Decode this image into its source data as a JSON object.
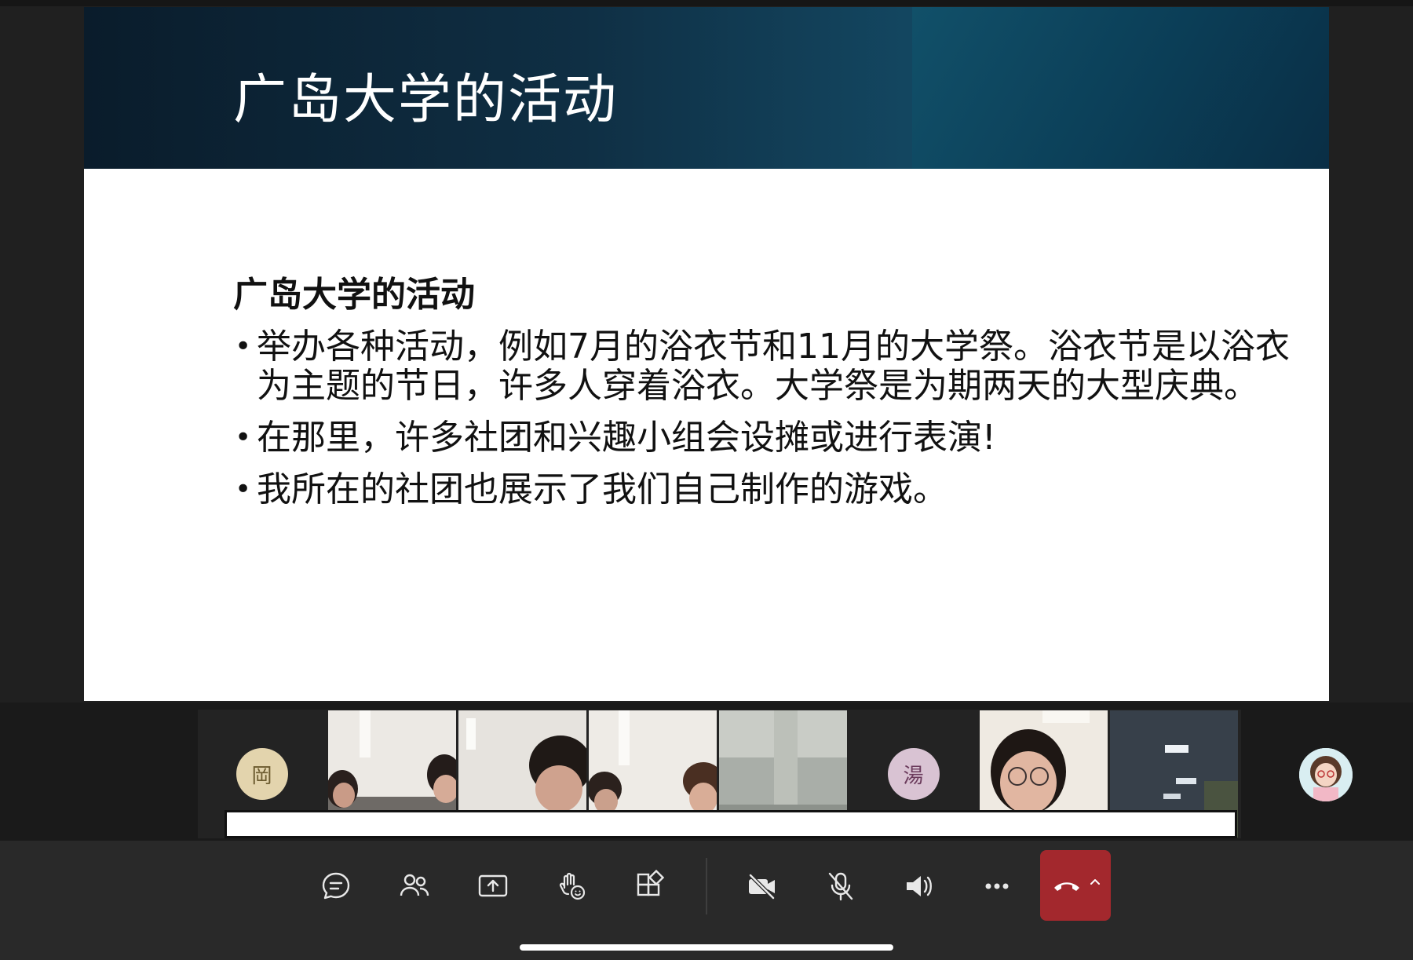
{
  "slide": {
    "title": "广岛大学的活动",
    "body_heading": "广岛大学的活动",
    "bullets": [
      "举办各种活动，例如7月的浴衣节和11月的大学祭。浴衣节是以浴衣为主题的节日，许多人穿着浴衣。大学祭是为期两天的大型庆典。",
      "在那里，许多社团和兴趣小组会设摊或进行表演!",
      "我所在的社团也展示了我们自己制作的游戏。"
    ]
  },
  "participants": [
    {
      "type": "initial",
      "initial": "岡",
      "bg": "#e3d4ad",
      "fg": "#6b5a2e"
    },
    {
      "type": "video",
      "icon": "camera-feed"
    },
    {
      "type": "video",
      "icon": "camera-feed",
      "active": true
    },
    {
      "type": "video",
      "icon": "camera-feed"
    },
    {
      "type": "video",
      "icon": "camera-feed"
    },
    {
      "type": "initial",
      "initial": "湯",
      "bg": "#d9c3d3",
      "fg": "#6b3b5c"
    },
    {
      "type": "video",
      "icon": "camera-feed"
    },
    {
      "type": "video",
      "icon": "camera-feed",
      "active": true
    }
  ],
  "toolbar": {
    "buttons": [
      "chat-icon",
      "people-icon",
      "share-screen-icon",
      "react-raise-hand-icon",
      "apps-icon",
      "camera-off-icon",
      "mic-off-icon",
      "speaker-icon",
      "more-options-icon"
    ],
    "hangup_icon": "hangup-icon",
    "hangup_color": "#a3282d"
  },
  "colors": {
    "header_dark": "#0a1c2b",
    "header_teal": "#134660",
    "active_tile_border": "#6a6fd1"
  }
}
